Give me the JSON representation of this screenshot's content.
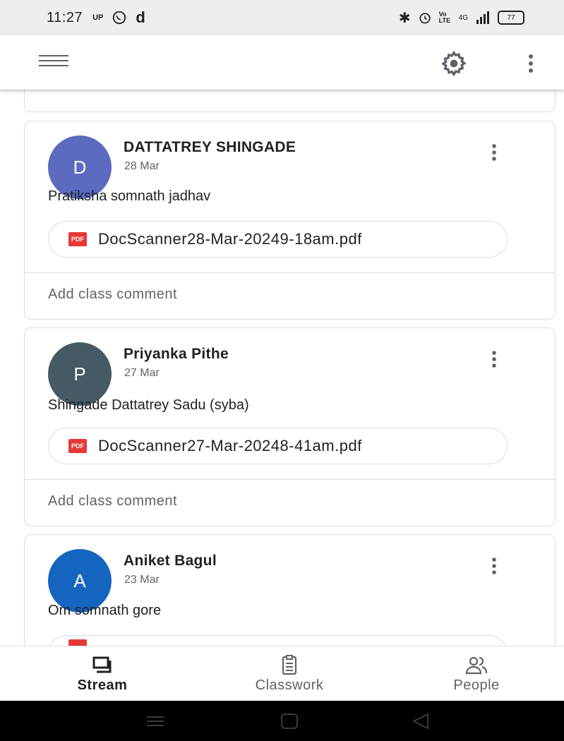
{
  "status_bar": {
    "time": "11:27",
    "left_badges": [
      "up",
      "whatsapp",
      "d"
    ],
    "right_badges": [
      "bluetooth",
      "alarm",
      "volte",
      "4g-signal",
      "battery"
    ],
    "volte_label": "Vo LTE",
    "net_label": "4G",
    "battery": "77"
  },
  "app_bar": {
    "icons": [
      "menu-icon",
      "settings-gear-icon",
      "more-vert-icon"
    ]
  },
  "posts": [
    {
      "author": "DATTATREY SHINGADE",
      "initial": "D",
      "avatar_color": "#5c6bc0",
      "date": "28 Mar",
      "text": "Pratiksha somnath jadhav",
      "attachment": "DocScanner28-Mar-20249-18am.pdf",
      "comment_placeholder": "Add class comment"
    },
    {
      "author": "Priyanka Pithe",
      "initial": "P",
      "avatar_color": "#455a64",
      "date": "27 Mar",
      "text": "Shingade Dattatrey Sadu (syba)",
      "attachment": "DocScanner27-Mar-20248-41am.pdf",
      "comment_placeholder": "Add class comment"
    },
    {
      "author": "Aniket Bagul",
      "initial": "A",
      "avatar_color": "#1565c0",
      "date": "23 Mar",
      "text": "Om somnath gore"
    }
  ],
  "pdf_badge": "PDF",
  "bottom_nav": {
    "tabs": [
      {
        "label": "Stream",
        "icon": "stream-icon",
        "active": true
      },
      {
        "label": "Classwork",
        "icon": "classwork-icon",
        "active": false
      },
      {
        "label": "People",
        "icon": "people-icon",
        "active": false
      }
    ],
    "active_color": "#202124",
    "inactive_color": "#5f6368"
  },
  "system_nav": [
    "recents-icon",
    "home-icon",
    "back-icon"
  ]
}
